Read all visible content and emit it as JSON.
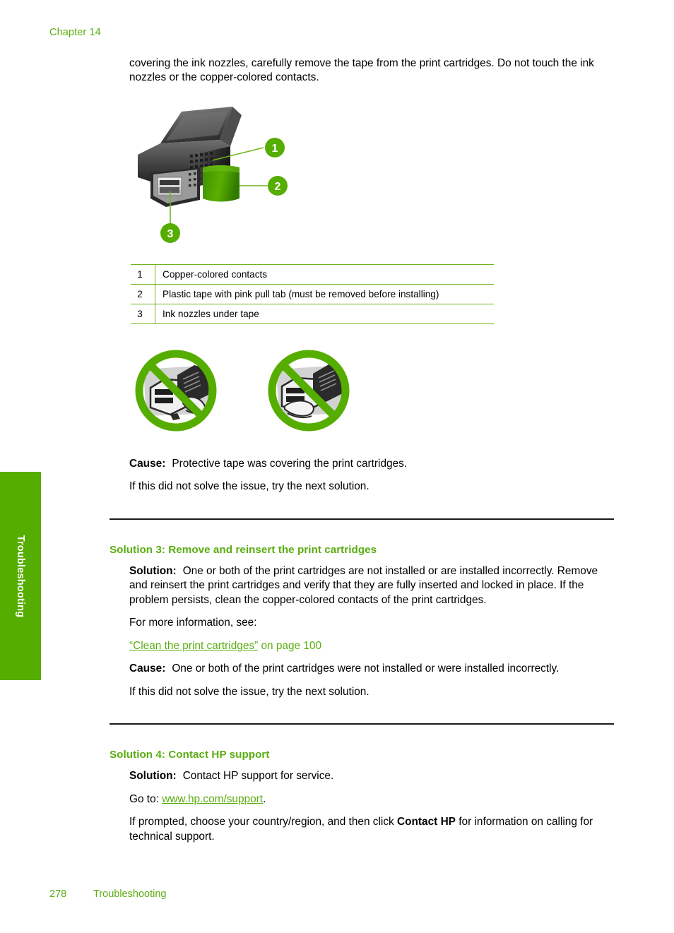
{
  "header": {
    "chapter": "Chapter 14"
  },
  "side_tab": {
    "label": "Troubleshooting",
    "color": "#55ad00"
  },
  "colors": {
    "green_heading": "#5aad10",
    "green_tab": "#55ad00",
    "green_rule": "#6fb41e",
    "text": "#000000",
    "rule_dark": "#1a1a1a"
  },
  "intro_paragraph": "covering the ink nozzles, carefully remove the tape from the print cartridges. Do not touch the ink nozzles or the copper-colored contacts.",
  "figure": {
    "name": "print-cartridge-callout-diagram",
    "callouts": [
      {
        "number": "1",
        "target": "copper-colored contacts"
      },
      {
        "number": "2",
        "target": "plastic tape with pink pull tab"
      },
      {
        "number": "3",
        "target": "ink nozzles under tape"
      }
    ],
    "legend": [
      {
        "num": "1",
        "desc": "Copper-colored contacts"
      },
      {
        "num": "2",
        "desc": "Plastic tape with pink pull tab (must be removed before installing)"
      },
      {
        "num": "3",
        "desc": "Ink nozzles under tape"
      }
    ]
  },
  "prohibition_icons": [
    {
      "name": "do-not-touch-ink-nozzles-icon",
      "caption": ""
    },
    {
      "name": "do-not-touch-copper-contacts-icon",
      "caption": ""
    }
  ],
  "section_tape": {
    "cause_label": "Cause:",
    "cause_text": "Protective tape was covering the print cartridges.",
    "next_solution_text": "If this did not solve the issue, try the next solution."
  },
  "solution_3": {
    "heading": "Solution 3: Remove and reinsert the print cartridges",
    "solution_label": "Solution:",
    "solution_text": "One or both of the print cartridges are not installed or are installed incorrectly. Remove and reinsert the print cartridges and verify that they are fully inserted and locked in place. If the problem persists, clean the copper-colored contacts of the print cartridges.",
    "more_info_label": "For more information, see:",
    "link_quoted_title": "“Clean the print cartridges”",
    "link_page_suffix": " on page 100",
    "cause_label": "Cause:",
    "cause_text": "One or both of the print cartridges were not installed or were installed incorrectly.",
    "next_solution_text": "If this did not solve the issue, try the next solution."
  },
  "solution_4": {
    "heading": "Solution 4: Contact HP support",
    "solution_label": "Solution:",
    "solution_text": "Contact HP support for service.",
    "goto_label": "Go to: ",
    "goto_link": "www.hp.com/support",
    "goto_suffix": ".",
    "prompt_text_before": "If prompted, choose your country/region, and then click ",
    "prompt_bold": "Contact HP",
    "prompt_text_after": " for information on calling for technical support."
  },
  "footer": {
    "page_number": "278",
    "section": "Troubleshooting"
  }
}
